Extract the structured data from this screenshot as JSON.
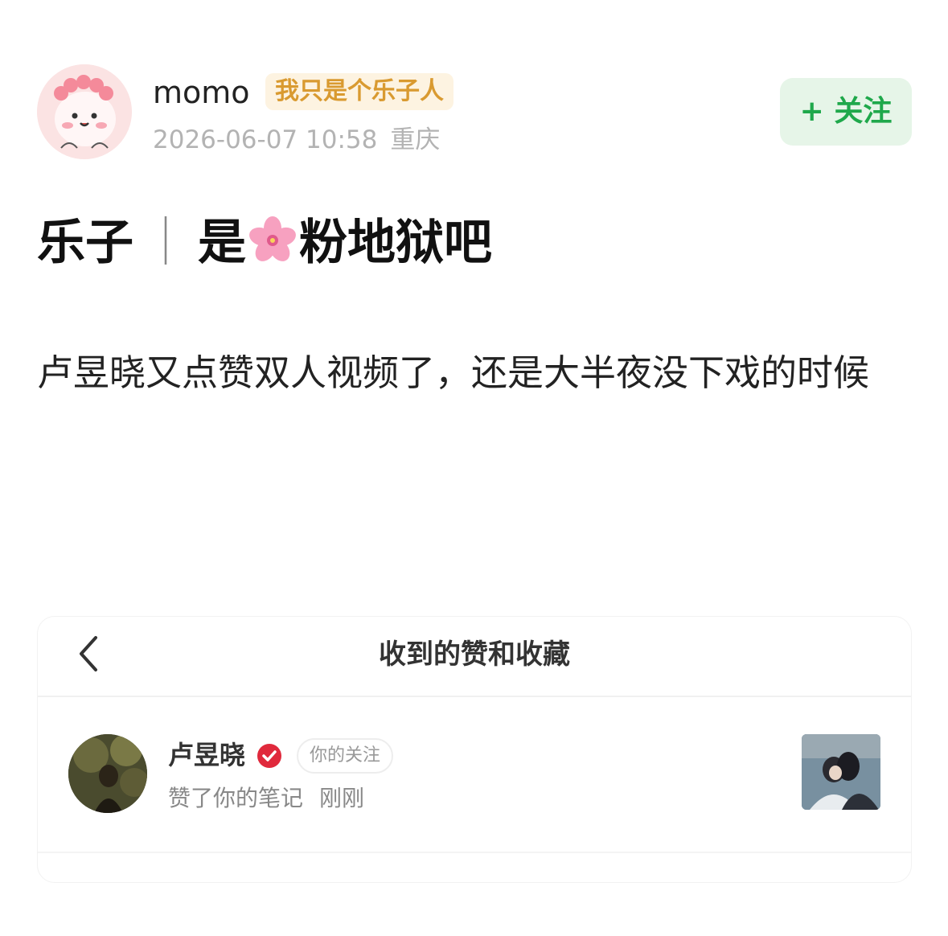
{
  "author": {
    "name": "momo",
    "tag": "我只是个乐子人",
    "timestamp": "2026-06-07 10:58",
    "location": "重庆",
    "avatar_icon": "cute-pink-character-avatar"
  },
  "follow_button": {
    "label": "+ 关注"
  },
  "post": {
    "title_part1": "乐子",
    "title_sep": "｜",
    "title_part2": "是",
    "title_emoji": "cherry-blossom-icon",
    "title_part3": "粉地狱吧",
    "body": "卢昱晓又点赞双人视频了，还是大半夜没下戏的时候"
  },
  "embedded_screenshot": {
    "header_title": "收到的赞和收藏",
    "back_icon": "chevron-left-icon",
    "notification": {
      "user_name": "卢昱晓",
      "verified_icon": "verified-badge-icon",
      "badge": "你的关注",
      "action": "赞了你的笔记",
      "time": "刚刚"
    }
  },
  "colors": {
    "follow_green": "#1fa84b",
    "tag_gold": "#d99a30",
    "verified_red": "#e0293c",
    "meta_gray": "#b3b3b3"
  }
}
